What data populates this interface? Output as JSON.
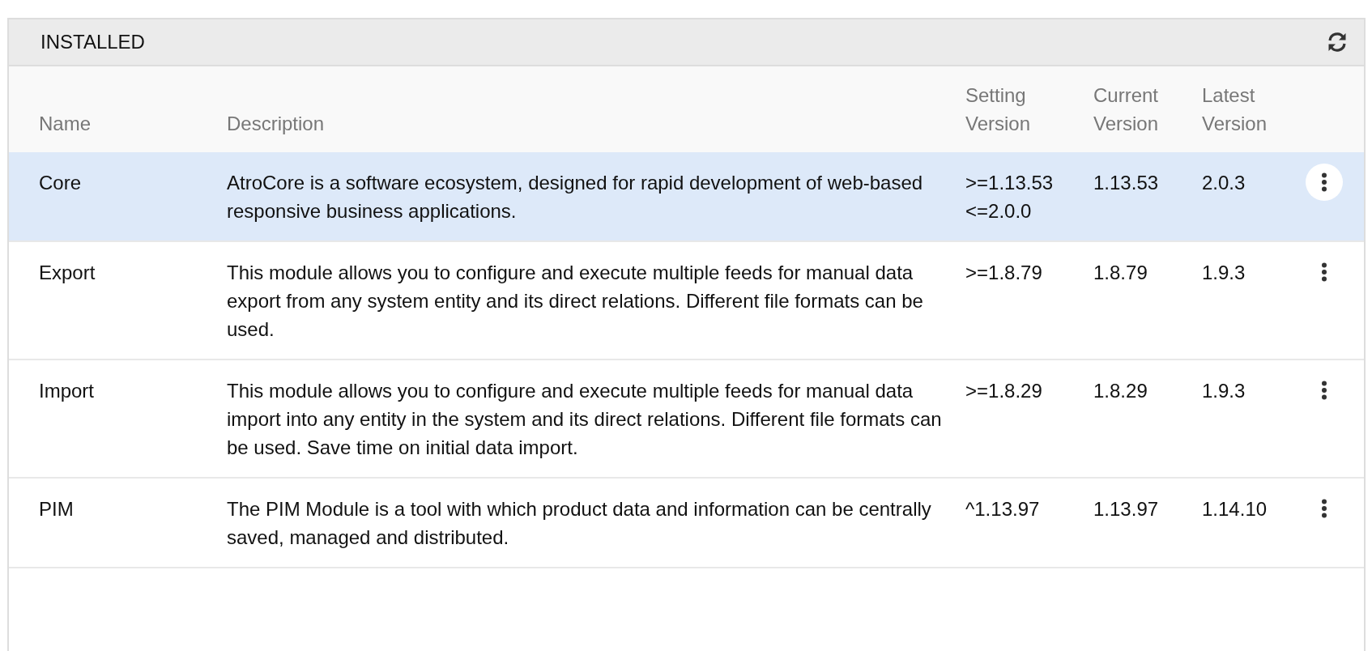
{
  "panel": {
    "title": "INSTALLED"
  },
  "table": {
    "columns": [
      "Name",
      "Description",
      "Setting Version",
      "Current Version",
      "Latest Version"
    ],
    "rows": [
      {
        "name": "Core",
        "description": "AtroCore is a software ecosystem, designed for rapid development of web-based responsive business applications.",
        "setting_version": ">=1.13.53 <=2.0.0",
        "current_version": "1.13.53",
        "latest_version": "2.0.3",
        "selected": true
      },
      {
        "name": "Export",
        "description": "This module allows you to configure and execute multiple feeds for manual data export from any system entity and its direct relations. Different file formats can be used.",
        "setting_version": ">=1.8.79",
        "current_version": "1.8.79",
        "latest_version": "1.9.3",
        "selected": false
      },
      {
        "name": "Import",
        "description": "This module allows you to configure and execute multiple feeds for manual data import into any entity in the system and its direct relations. Different file formats can be used. Save time on initial data import.",
        "setting_version": ">=1.8.29",
        "current_version": "1.8.29",
        "latest_version": "1.9.3",
        "selected": false
      },
      {
        "name": "PIM",
        "description": "The PIM Module is a tool with which product data and information can be centrally saved, managed and distributed.",
        "setting_version": "^1.13.97",
        "current_version": "1.13.97",
        "latest_version": "1.14.10",
        "selected": false
      }
    ]
  }
}
